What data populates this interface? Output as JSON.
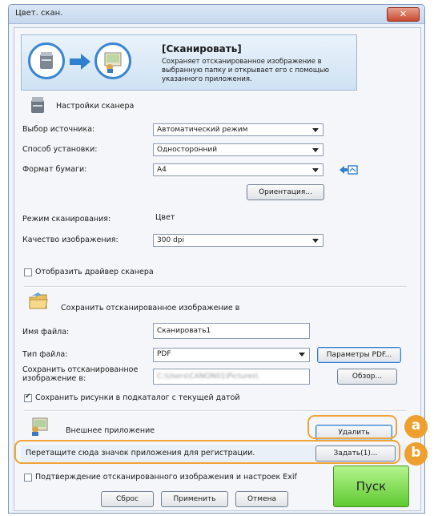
{
  "window": {
    "title": "Цвет. скан."
  },
  "banner": {
    "title": "[Сканировать]",
    "description": "Сохраняет отсканированное изображение в выбранную папку и открывает его с помощью указанного приложения."
  },
  "scanner_settings": {
    "heading": "Настройки сканера",
    "source_label": "Выбор источника:",
    "source_value": "Автоматический режим",
    "mode_label": "Способ установки:",
    "mode_value": "Односторонний",
    "paper_label": "Формат бумаги:",
    "paper_value": "A4",
    "orientation_button": "Ориентация...",
    "scan_mode_label": "Режим сканирования:",
    "scan_mode_value": "Цвет",
    "quality_label": "Качество изображения:",
    "quality_value": "300 dpi",
    "show_driver_label": "Отобразить драйвер сканера"
  },
  "save_settings": {
    "heading": "Сохранить отсканированное изображение в",
    "filename_label": "Имя файла:",
    "filename_value": "Сканировать1",
    "filetype_label": "Тип файла:",
    "filetype_value": "PDF",
    "pdf_params_button": "Параметры PDF...",
    "save_location_label": "Сохранить отсканированное изображение в:",
    "save_location_value": "C:\\Users\\CANON01\\Pictures\\",
    "browse_button": "Обзор...",
    "subfolder_label": "Сохранить рисунки в подкаталог с текущей датой"
  },
  "external_app": {
    "heading": "Внешнее приложение",
    "delete_button": "Удалить",
    "drop_hint": "Перетащите сюда значок приложения для регистрации.",
    "set_button": "Задать(1)..."
  },
  "footer": {
    "confirm_exif_label": "Подтверждение отсканированного изображения и настроек Exif",
    "reset_button": "Сброс",
    "apply_button": "Применить",
    "cancel_button": "Отмена",
    "start_button": "Пуск"
  },
  "markers": {
    "a": "a",
    "b": "b"
  },
  "colors": {
    "accent": "#3b86d0",
    "marker": "#ef9f2d",
    "start": "#5fc931",
    "close": "#c9492f"
  },
  "icons": [
    "scanner-icon",
    "arrow-right-icon",
    "application-icon",
    "folder-icon",
    "app-window-icon",
    "paper-rotate-icon",
    "close-icon"
  ]
}
